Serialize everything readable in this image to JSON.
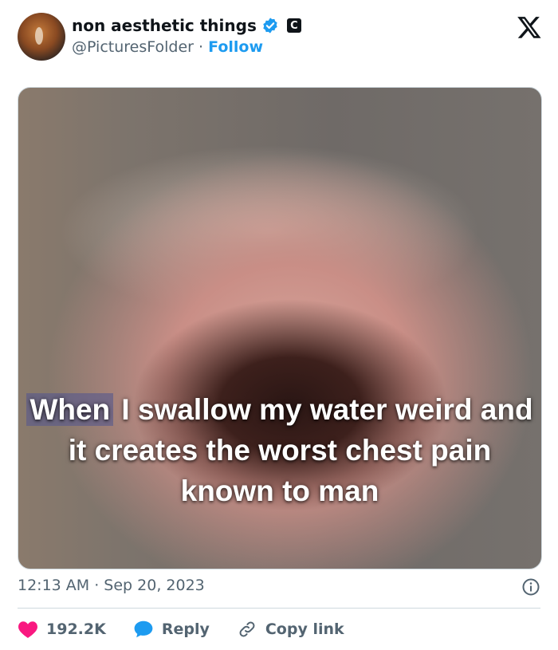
{
  "author": {
    "name": "non aesthetic things",
    "handle": "@PicturesFolder",
    "separator": "·",
    "follow_label": "Follow",
    "badge_letter": "C"
  },
  "media": {
    "caption_highlight": "When",
    "caption_rest": " I swallow my water weird and it creates the worst chest pain known to man"
  },
  "timestamp": "12:13 AM · Sep 20, 2023",
  "actions": {
    "likes": "192.2K",
    "reply_label": "Reply",
    "copy_link_label": "Copy link"
  },
  "colors": {
    "accent": "#1d9bf0",
    "like": "#f91880",
    "text_secondary": "#536471"
  },
  "icons": [
    "x-logo-icon",
    "verified-icon",
    "info-icon",
    "heart-icon",
    "reply-bubble-icon",
    "link-icon"
  ]
}
